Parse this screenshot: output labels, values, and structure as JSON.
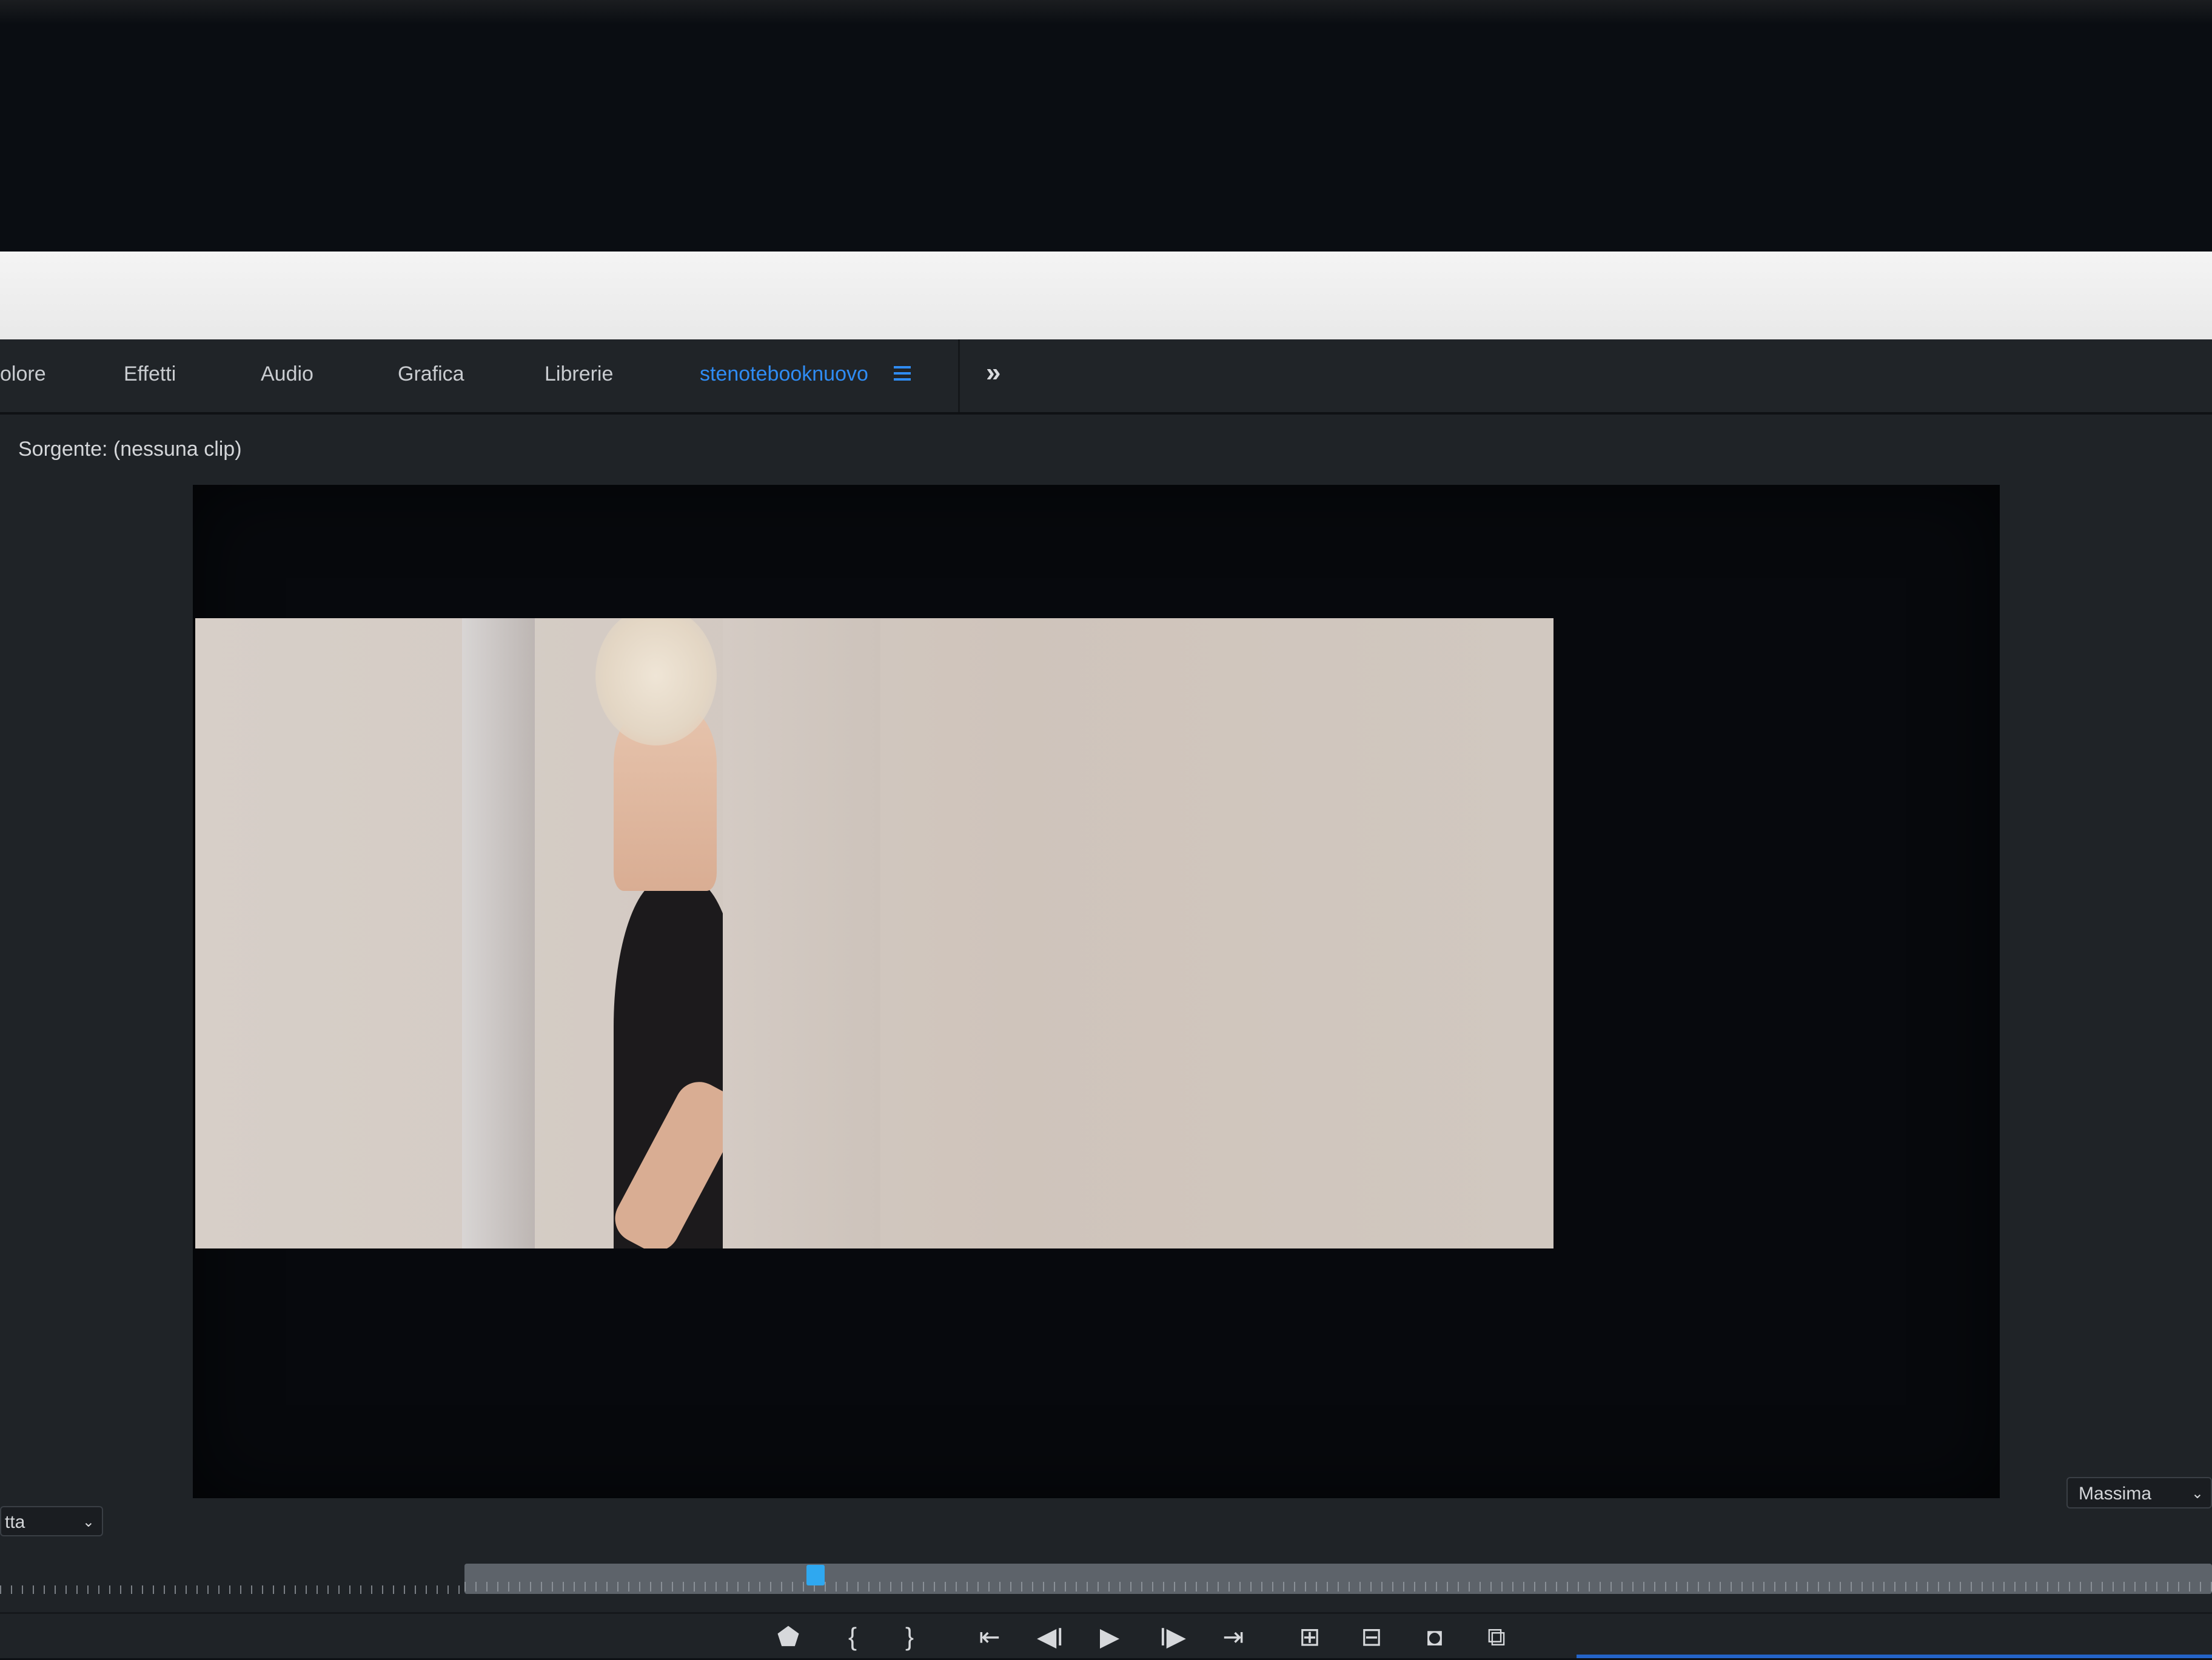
{
  "workspace_tabs": [
    {
      "label": "olore"
    },
    {
      "label": "Effetti"
    },
    {
      "label": "Audio"
    },
    {
      "label": "Grafica"
    },
    {
      "label": "Librerie"
    },
    {
      "label": "stenotebooknuovo",
      "active": true
    }
  ],
  "more_label": "»",
  "source_panel": {
    "title": "Sorgente: (nessuna clip)"
  },
  "fit_select": {
    "value": "tta"
  },
  "quality_select": {
    "value": "Massima"
  },
  "transport_buttons": [
    {
      "name": "add-marker",
      "glyph": "⬟"
    },
    {
      "name": "mark-in",
      "glyph": "{"
    },
    {
      "name": "mark-out",
      "glyph": "}"
    },
    {
      "name": "go-to-in",
      "glyph": "⇤"
    },
    {
      "name": "step-back",
      "glyph": "◀I"
    },
    {
      "name": "play",
      "glyph": "▶"
    },
    {
      "name": "step-forward",
      "glyph": "I▶"
    },
    {
      "name": "go-to-out",
      "glyph": "⇥"
    },
    {
      "name": "insert",
      "glyph": "⊞"
    },
    {
      "name": "overwrite",
      "glyph": "⊟"
    },
    {
      "name": "export-frame",
      "glyph": "◘"
    },
    {
      "name": "button-editor",
      "glyph": "⧉"
    }
  ],
  "colors": {
    "accent": "#2f8cf4",
    "playhead": "#2fa8f0",
    "panel_bg": "#1f2327"
  }
}
